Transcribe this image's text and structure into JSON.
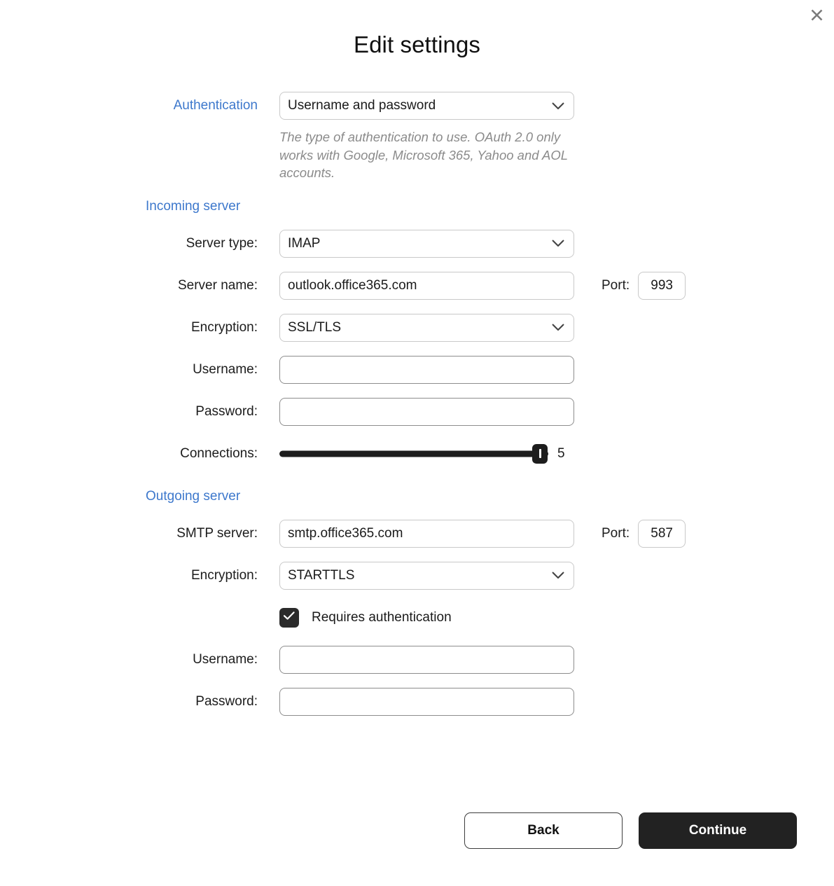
{
  "dialog": {
    "title": "Edit settings",
    "close_icon": "close-icon"
  },
  "authentication": {
    "label": "Authentication",
    "value": "Username and password",
    "chevron_icon": "chevron-down-icon",
    "helper_text": "The type of authentication to use. OAuth 2.0 only works with Google, Microsoft 365, Yahoo and AOL accounts."
  },
  "incoming": {
    "heading": "Incoming server",
    "server_type": {
      "label": "Server type:",
      "value": "IMAP"
    },
    "server_name": {
      "label": "Server name:",
      "value": "outlook.office365.com",
      "placeholder": ""
    },
    "port": {
      "label": "Port:",
      "value": "993"
    },
    "encryption": {
      "label": "Encryption:",
      "value": "SSL/TLS"
    },
    "username": {
      "label": "Username:",
      "value": "",
      "placeholder": ""
    },
    "password": {
      "label": "Password:",
      "value": "",
      "placeholder": ""
    },
    "connections": {
      "label": "Connections:",
      "value": "5",
      "min": 1,
      "max": 5,
      "percent": 97
    }
  },
  "outgoing": {
    "heading": "Outgoing server",
    "smtp_server": {
      "label": "SMTP server:",
      "value": "smtp.office365.com",
      "placeholder": ""
    },
    "port": {
      "label": "Port:",
      "value": "587"
    },
    "encryption": {
      "label": "Encryption:",
      "value": "STARTTLS"
    },
    "requires_auth": {
      "label": "Requires authentication",
      "checked": true,
      "check_icon": "check-icon"
    },
    "username": {
      "label": "Username:",
      "value": "",
      "placeholder": ""
    },
    "password": {
      "label": "Password:",
      "value": "",
      "placeholder": ""
    }
  },
  "footer": {
    "back_label": "Back",
    "continue_label": "Continue"
  },
  "colors": {
    "accent_blue": "#3d78cc",
    "primary_dark": "#222222",
    "helper_gray": "#8b8b8b",
    "border_gray": "#c9c9c9"
  }
}
